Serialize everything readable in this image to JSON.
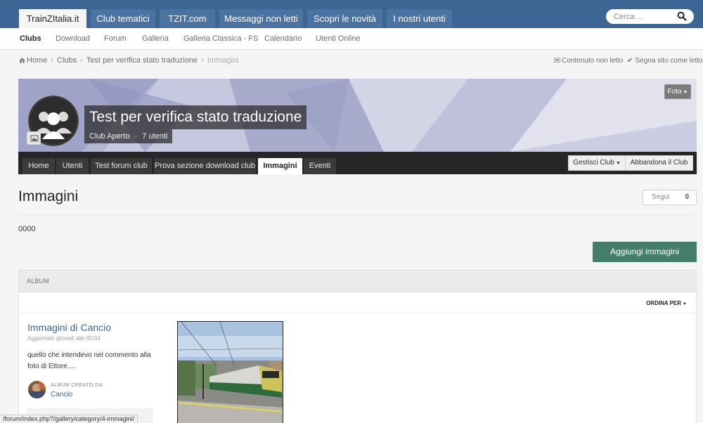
{
  "header": {
    "tabs": [
      "TrainZItalia.it",
      "Club tematici",
      "TZIT.com",
      "Messaggi non letti",
      "Scopri le novità",
      "I nostri utenti"
    ],
    "search_placeholder": "Cerca ..."
  },
  "subnav": {
    "items": [
      "Clubs",
      "Download",
      "Forum",
      "Galleria",
      "Galleria Classica - FS",
      "Calendario",
      "Utenti Online"
    ]
  },
  "breadcrumb": {
    "items": [
      "Home",
      "Clubs",
      "Test per verifica stato traduzione",
      "Immagini"
    ],
    "unread": "Contenuto non letto",
    "mark_read": "Segna sito come letto"
  },
  "club": {
    "title": "Test per verifica stato traduzione",
    "type": "Club Aperto",
    "sep": "·",
    "members": "7 utenti",
    "foto_button": "Foto",
    "tabs": [
      "Home",
      "Utenti",
      "Test forum club",
      "Prova sezione download club",
      "Immagini",
      "Eventi"
    ],
    "manage_button": "Gestisci Club",
    "leave_button": "Abbandona il Club"
  },
  "page": {
    "title": "Immagini",
    "follow_label": "Segui",
    "follow_count": "0",
    "description": "0000",
    "add_button": "Aggiungi immagini"
  },
  "album_section": {
    "header": "ALBUM",
    "sort_label": "ORDINA PER",
    "album": {
      "name": "Immagini di Cancio",
      "updated": "Aggiornato giovedì alle 00:03",
      "description": "quello che intendevo nel commento alla foto di Ettore....",
      "created_by_label": "ALBUM CREATO DA",
      "creator": "Cancio"
    }
  },
  "status_url": "/forum/index.php?/gallery/category/4-immagini/",
  "colors": {
    "header_blue": "#3d6594",
    "accent_green": "#447e6a",
    "link_blue": "#3d6594"
  }
}
